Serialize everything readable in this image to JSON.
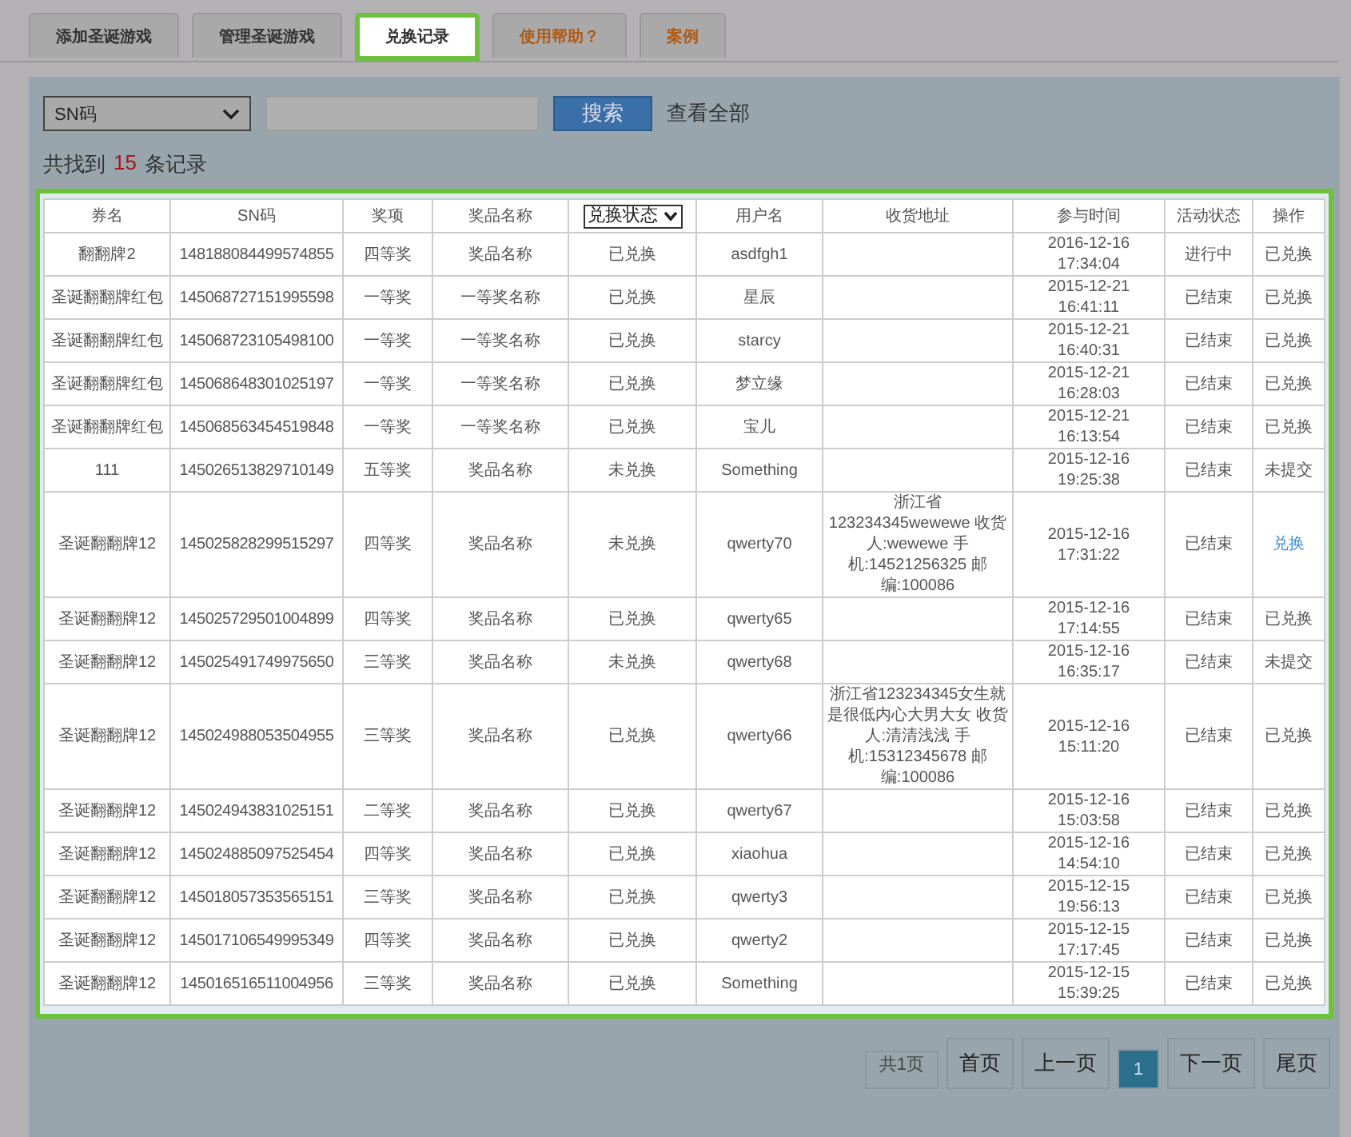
{
  "tabs": [
    {
      "label": "添加圣诞游戏",
      "selected": false,
      "accent": false
    },
    {
      "label": "管理圣诞游戏",
      "selected": false,
      "accent": false
    },
    {
      "label": "兑换记录",
      "selected": true,
      "accent": false
    },
    {
      "label": "使用帮助？",
      "selected": false,
      "accent": true
    },
    {
      "label": "案例",
      "selected": false,
      "accent": true
    }
  ],
  "search": {
    "field_select": "SN码",
    "button": "搜索",
    "view_all": "查看全部"
  },
  "summary": {
    "prefix": "共找到",
    "count": "15",
    "suffix": "条记录"
  },
  "table": {
    "columns": [
      {
        "label": "券名",
        "kind": "text"
      },
      {
        "label": "SN码",
        "kind": "text"
      },
      {
        "label": "奖项",
        "kind": "text"
      },
      {
        "label": "奖品名称",
        "kind": "text"
      },
      {
        "label": "兑换状态",
        "kind": "dropdown"
      },
      {
        "label": "用户名",
        "kind": "text"
      },
      {
        "label": "收货地址",
        "kind": "text"
      },
      {
        "label": "参与时间",
        "kind": "text"
      },
      {
        "label": "活动状态",
        "kind": "text"
      },
      {
        "label": "操作",
        "kind": "text"
      }
    ],
    "rows": [
      {
        "cells": [
          "翻翻牌2",
          "148188084499574855",
          "四等奖",
          "奖品名称",
          "已兑换",
          "asdfgh1",
          "",
          "2016-12-16 17:34:04",
          "进行中",
          "已兑换"
        ],
        "action_link": false
      },
      {
        "cells": [
          "圣诞翻翻牌红包",
          "145068727151995598",
          "一等奖",
          "一等奖名称",
          "已兑换",
          "星辰",
          "",
          "2015-12-21 16:41:11",
          "已结束",
          "已兑换"
        ],
        "action_link": false
      },
      {
        "cells": [
          "圣诞翻翻牌红包",
          "145068723105498100",
          "一等奖",
          "一等奖名称",
          "已兑换",
          "starcy",
          "",
          "2015-12-21 16:40:31",
          "已结束",
          "已兑换"
        ],
        "action_link": false
      },
      {
        "cells": [
          "圣诞翻翻牌红包",
          "145068648301025197",
          "一等奖",
          "一等奖名称",
          "已兑换",
          "梦立缘",
          "",
          "2015-12-21 16:28:03",
          "已结束",
          "已兑换"
        ],
        "action_link": false
      },
      {
        "cells": [
          "圣诞翻翻牌红包",
          "145068563454519848",
          "一等奖",
          "一等奖名称",
          "已兑换",
          "宝儿",
          "",
          "2015-12-21 16:13:54",
          "已结束",
          "已兑换"
        ],
        "action_link": false
      },
      {
        "cells": [
          "111",
          "145026513829710149",
          "五等奖",
          "奖品名称",
          "未兑换",
          "Something",
          "",
          "2015-12-16 19:25:38",
          "已结束",
          "未提交"
        ],
        "action_link": false
      },
      {
        "cells": [
          "圣诞翻翻牌12",
          "145025828299515297",
          "四等奖",
          "奖品名称",
          "未兑换",
          "qwerty70",
          "浙江省123234345wewewe 收货人:wewewe 手机:14521256325 邮编:100086",
          "2015-12-16 17:31:22",
          "已结束",
          "兑换"
        ],
        "action_link": true
      },
      {
        "cells": [
          "圣诞翻翻牌12",
          "145025729501004899",
          "四等奖",
          "奖品名称",
          "已兑换",
          "qwerty65",
          "",
          "2015-12-16 17:14:55",
          "已结束",
          "已兑换"
        ],
        "action_link": false
      },
      {
        "cells": [
          "圣诞翻翻牌12",
          "145025491749975650",
          "三等奖",
          "奖品名称",
          "未兑换",
          "qwerty68",
          "",
          "2015-12-16 16:35:17",
          "已结束",
          "未提交"
        ],
        "action_link": false
      },
      {
        "cells": [
          "圣诞翻翻牌12",
          "145024988053504955",
          "三等奖",
          "奖品名称",
          "已兑换",
          "qwerty66",
          "浙江省123234345女生就是很低内心大男大女 收货人:清清浅浅 手机:15312345678 邮编:100086",
          "2015-12-16 15:11:20",
          "已结束",
          "已兑换"
        ],
        "action_link": false
      },
      {
        "cells": [
          "圣诞翻翻牌12",
          "145024943831025151",
          "二等奖",
          "奖品名称",
          "已兑换",
          "qwerty67",
          "",
          "2015-12-16 15:03:58",
          "已结束",
          "已兑换"
        ],
        "action_link": false
      },
      {
        "cells": [
          "圣诞翻翻牌12",
          "145024885097525454",
          "四等奖",
          "奖品名称",
          "已兑换",
          "xiaohua",
          "",
          "2015-12-16 14:54:10",
          "已结束",
          "已兑换"
        ],
        "action_link": false
      },
      {
        "cells": [
          "圣诞翻翻牌12",
          "145018057353565151",
          "三等奖",
          "奖品名称",
          "已兑换",
          "qwerty3",
          "",
          "2015-12-15 19:56:13",
          "已结束",
          "已兑换"
        ],
        "action_link": false
      },
      {
        "cells": [
          "圣诞翻翻牌12",
          "145017106549995349",
          "四等奖",
          "奖品名称",
          "已兑换",
          "qwerty2",
          "",
          "2015-12-15 17:17:45",
          "已结束",
          "已兑换"
        ],
        "action_link": false
      },
      {
        "cells": [
          "圣诞翻翻牌12",
          "145016516511004956",
          "三等奖",
          "奖品名称",
          "已兑换",
          "Something",
          "",
          "2015-12-15 15:39:25",
          "已结束",
          "已兑换"
        ],
        "action_link": false
      }
    ]
  },
  "pagination": {
    "total": "共1页",
    "pages": [
      {
        "label": "首页",
        "selected": false
      },
      {
        "label": "上一页",
        "selected": false
      },
      {
        "label": "1",
        "selected": true
      },
      {
        "label": "下一页",
        "selected": false
      },
      {
        "label": "尾页",
        "selected": false
      }
    ]
  }
}
